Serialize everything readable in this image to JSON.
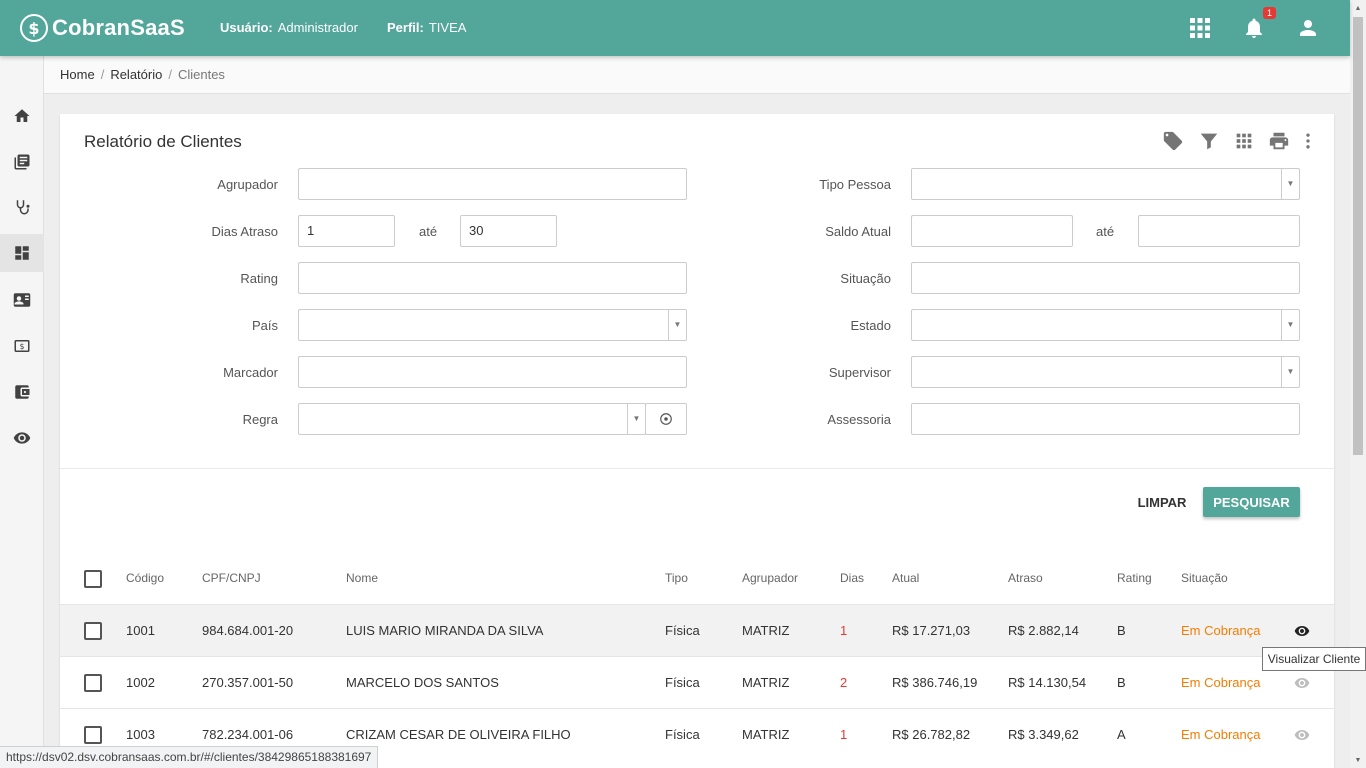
{
  "header": {
    "logo_mark": "$",
    "logo_text": "CobranSaaS",
    "user_label": "Usuário:",
    "user_value": "Administrador",
    "profile_label": "Perfil:",
    "profile_value": "TIVEA",
    "notification_count": "1",
    "bg_color": "#52a69a"
  },
  "sidebar": {
    "items": [
      {
        "icon": "home-icon"
      },
      {
        "icon": "book-icon"
      },
      {
        "icon": "stethoscope-icon"
      },
      {
        "icon": "dashboard-icon",
        "active": true
      },
      {
        "icon": "contact-card-icon"
      },
      {
        "icon": "money-icon"
      },
      {
        "icon": "wallet-icon"
      },
      {
        "icon": "eye-icon"
      }
    ]
  },
  "breadcrumb": {
    "home": "Home",
    "relatorio": "Relatório",
    "current": "Clientes",
    "sep": "/"
  },
  "card": {
    "title": "Relatório de Clientes",
    "tools": [
      "tag-icon",
      "filter-icon",
      "grid-icon",
      "print-icon",
      "more-vert-icon"
    ]
  },
  "form": {
    "agrupador_label": "Agrupador",
    "dias_atraso_label": "Dias Atraso",
    "dias_from": "1",
    "ate": "até",
    "dias_to": "30",
    "rating_label": "Rating",
    "pais_label": "País",
    "marcador_label": "Marcador",
    "regra_label": "Regra",
    "tipo_pessoa_label": "Tipo Pessoa",
    "saldo_atual_label": "Saldo Atual",
    "situacao_label": "Situação",
    "estado_label": "Estado",
    "supervisor_label": "Supervisor",
    "assessoria_label": "Assessoria",
    "arrow": "▼"
  },
  "actions": {
    "clear": "LIMPAR",
    "search": "PESQUISAR"
  },
  "table": {
    "headers": {
      "codigo": "Código",
      "cpf": "CPF/CNPJ",
      "nome": "Nome",
      "tipo": "Tipo",
      "agrupador": "Agrupador",
      "dias": "Dias",
      "atual": "Atual",
      "atraso": "Atraso",
      "rating": "Rating",
      "situacao": "Situação"
    },
    "rows": [
      {
        "codigo": "1001",
        "cpf": "984.684.001-20",
        "nome": "LUIS MARIO MIRANDA DA SILVA",
        "tipo": "Física",
        "agrupador": "MATRIZ",
        "dias": "1",
        "atual": "R$ 17.271,03",
        "atraso": "R$ 2.882,14",
        "rating": "B",
        "situacao": "Em Cobrança"
      },
      {
        "codigo": "1002",
        "cpf": "270.357.001-50",
        "nome": "MARCELO DOS SANTOS",
        "tipo": "Física",
        "agrupador": "MATRIZ",
        "dias": "2",
        "atual": "R$ 386.746,19",
        "atraso": "R$ 14.130,54",
        "rating": "B",
        "situacao": "Em Cobrança"
      },
      {
        "codigo": "1003",
        "cpf": "782.234.001-06",
        "nome": "CRIZAM CESAR DE OLIVEIRA FILHO",
        "tipo": "Física",
        "agrupador": "MATRIZ",
        "dias": "1",
        "atual": "R$ 26.782,82",
        "atraso": "R$ 3.349,62",
        "rating": "A",
        "situacao": "Em Cobrança"
      }
    ]
  },
  "tooltip": "Visualizar Cliente",
  "status_url": "https://dsv02.dsv.cobransaas.com.br/#/clientes/38429865188381697",
  "scroll": {
    "up": "▲",
    "down": "▼"
  }
}
